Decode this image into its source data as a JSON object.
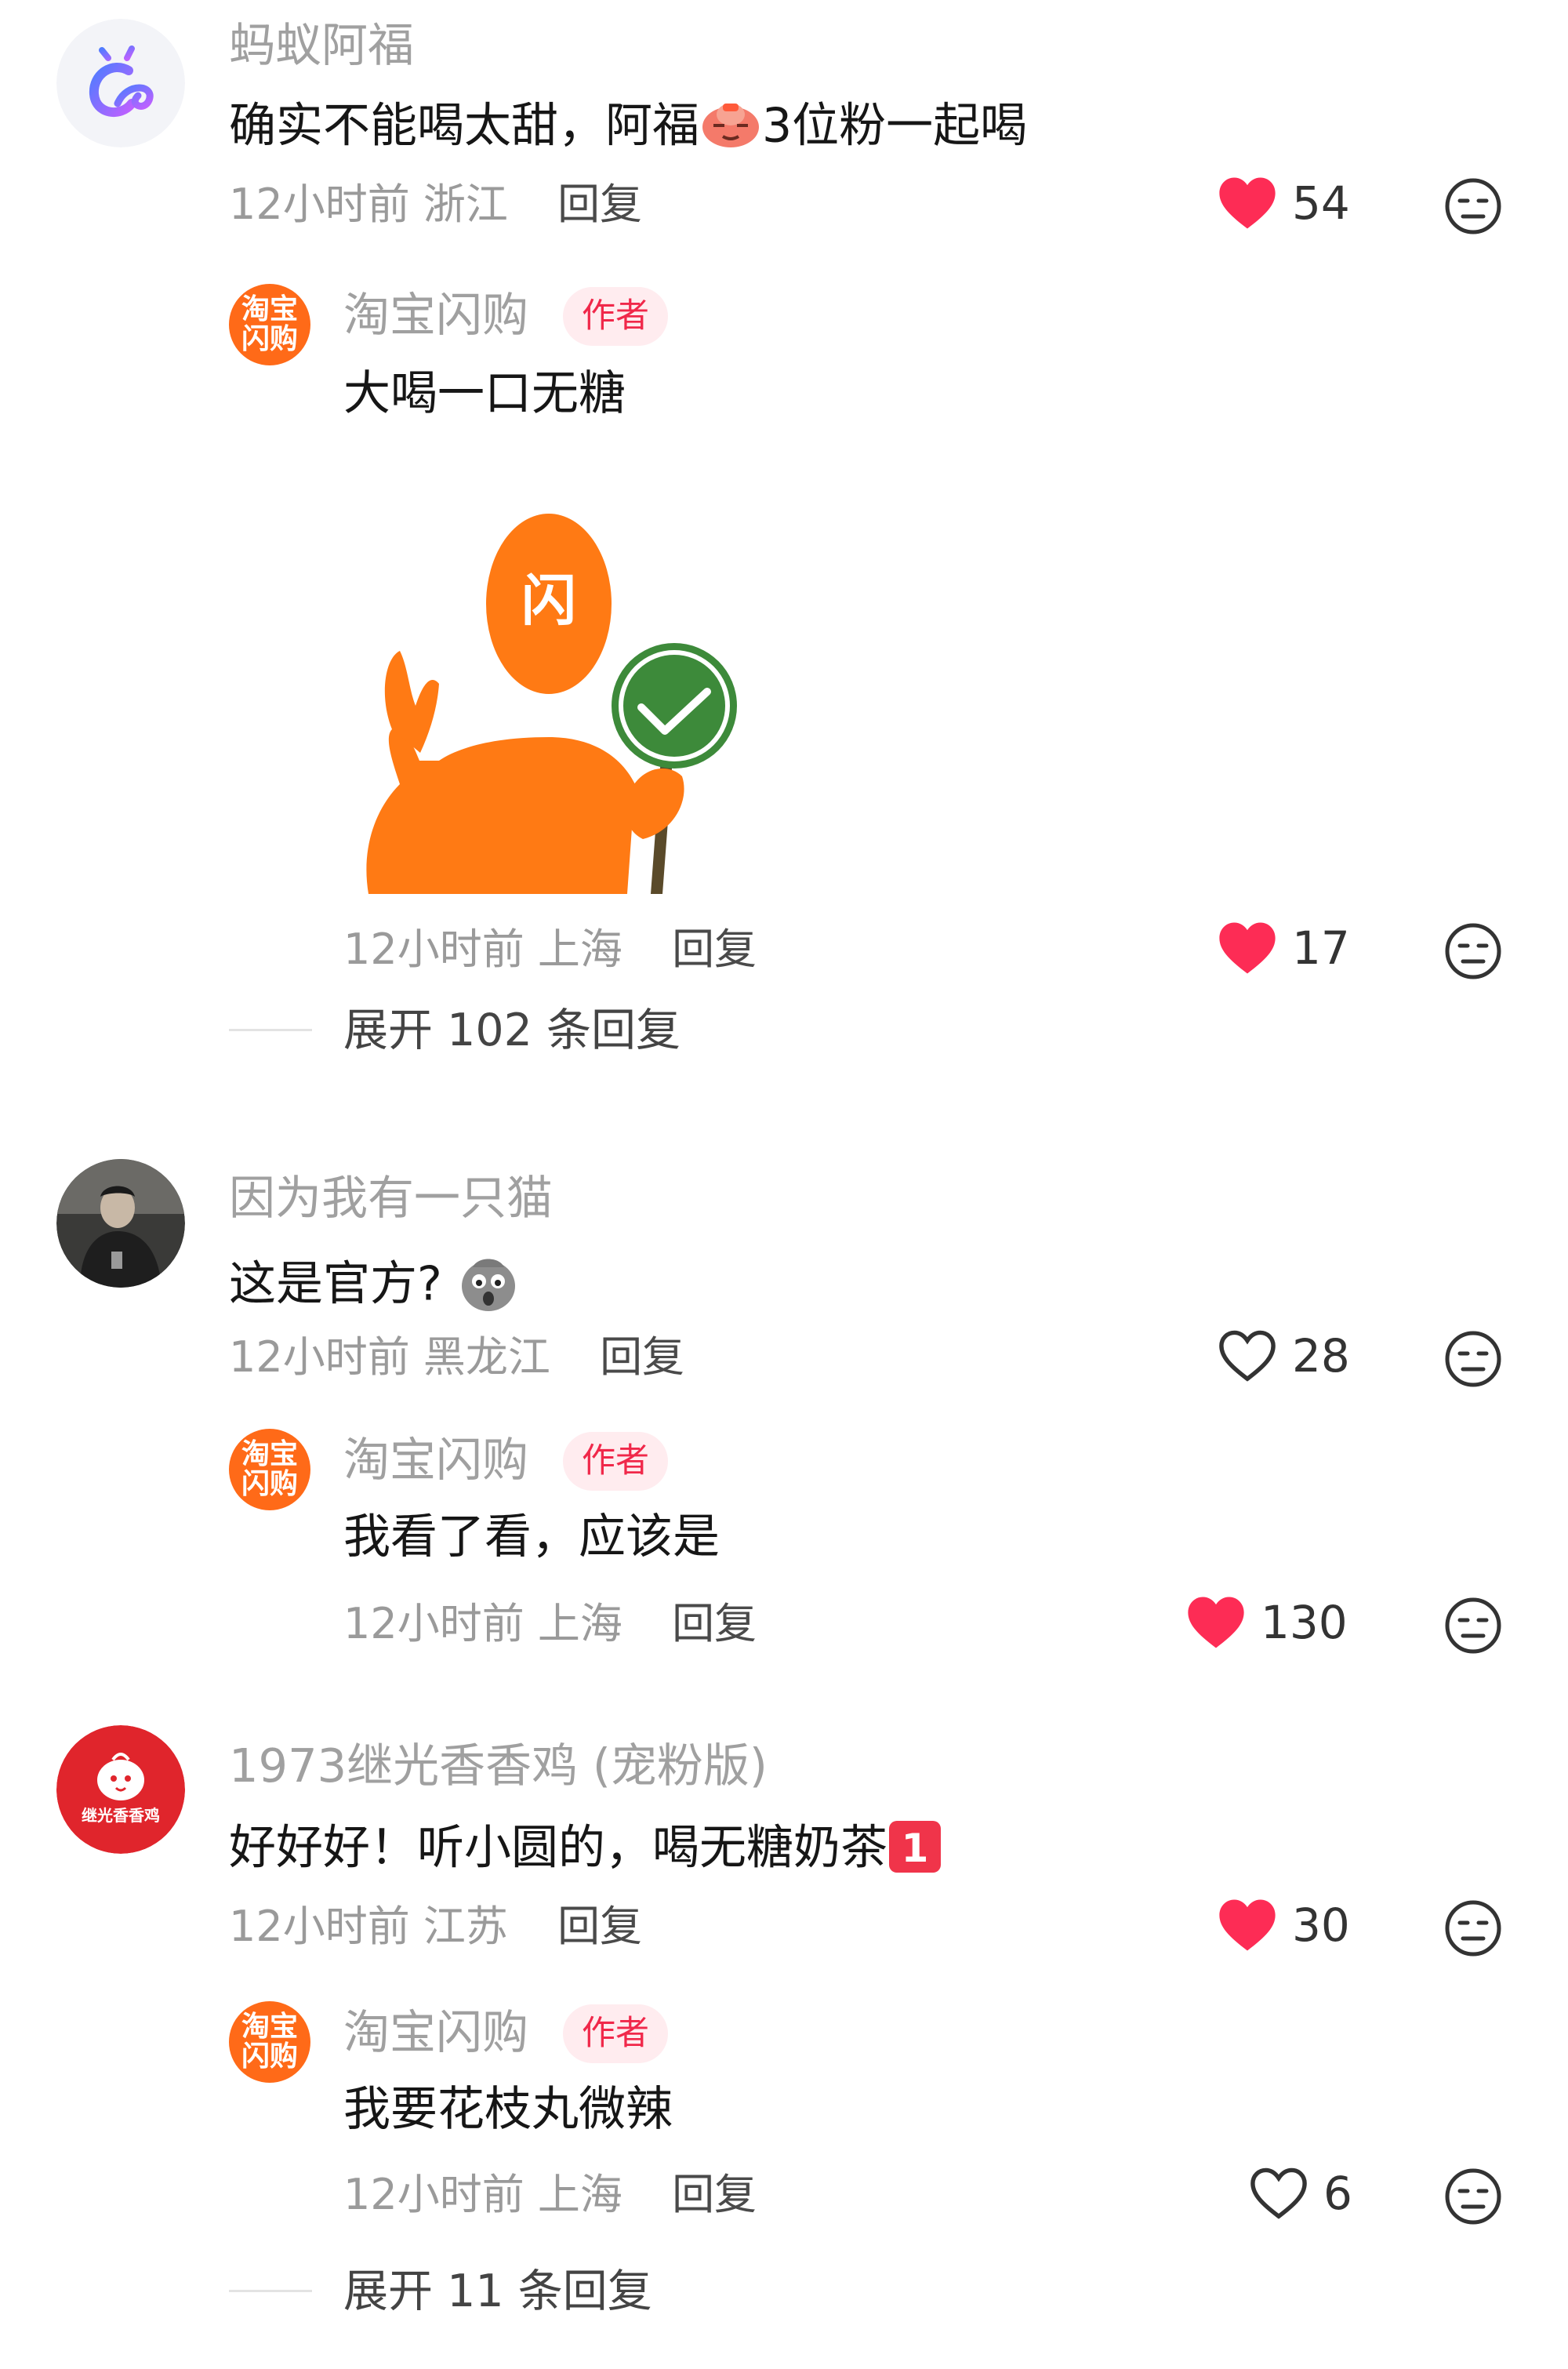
{
  "comments": [
    {
      "username": "蚂蚁阿福",
      "text_before": "确实不能喝太甜，阿福",
      "text_after": "3位粉一起喝",
      "time": "12小时前",
      "location": "浙江",
      "reply_label": "回复",
      "likes": "54",
      "liked": true,
      "reply": {
        "username": "淘宝闪购",
        "badge": "作者",
        "text": "大喝一口无糖",
        "sticker_char": "闪",
        "time": "12小时前",
        "location": "上海",
        "reply_label": "回复",
        "likes": "17",
        "liked": true
      },
      "expand_label": "展开 102 条回复"
    },
    {
      "username": "因为我有一只猫",
      "text": "这是官方?",
      "time": "12小时前",
      "location": "黑龙江",
      "reply_label": "回复",
      "likes": "28",
      "liked": false,
      "reply": {
        "username": "淘宝闪购",
        "badge": "作者",
        "text": "我看了看，应该是",
        "time": "12小时前",
        "location": "上海",
        "reply_label": "回复",
        "likes": "130",
        "liked": true
      }
    },
    {
      "username": "1973继光香香鸡 (宠粉版)",
      "avatar_text": "继光香香鸡",
      "text": "好好好！听小圆的，喝无糖奶茶",
      "emoji_number": "1",
      "time": "12小时前",
      "location": "江苏",
      "reply_label": "回复",
      "likes": "30",
      "liked": true,
      "reply": {
        "username": "淘宝闪购",
        "badge": "作者",
        "text": "我要花枝丸微辣",
        "time": "12小时前",
        "location": "上海",
        "reply_label": "回复",
        "likes": "6",
        "liked": false
      },
      "expand_label": "展开 11 条回复"
    }
  ],
  "author_avatar": {
    "line1": "淘宝",
    "line2": "闪购"
  },
  "colors": {
    "like_red": "#fd2c55",
    "author_orange": "#ff6a18",
    "badge_bg": "#ffecef",
    "badge_text": "#f0284a"
  }
}
